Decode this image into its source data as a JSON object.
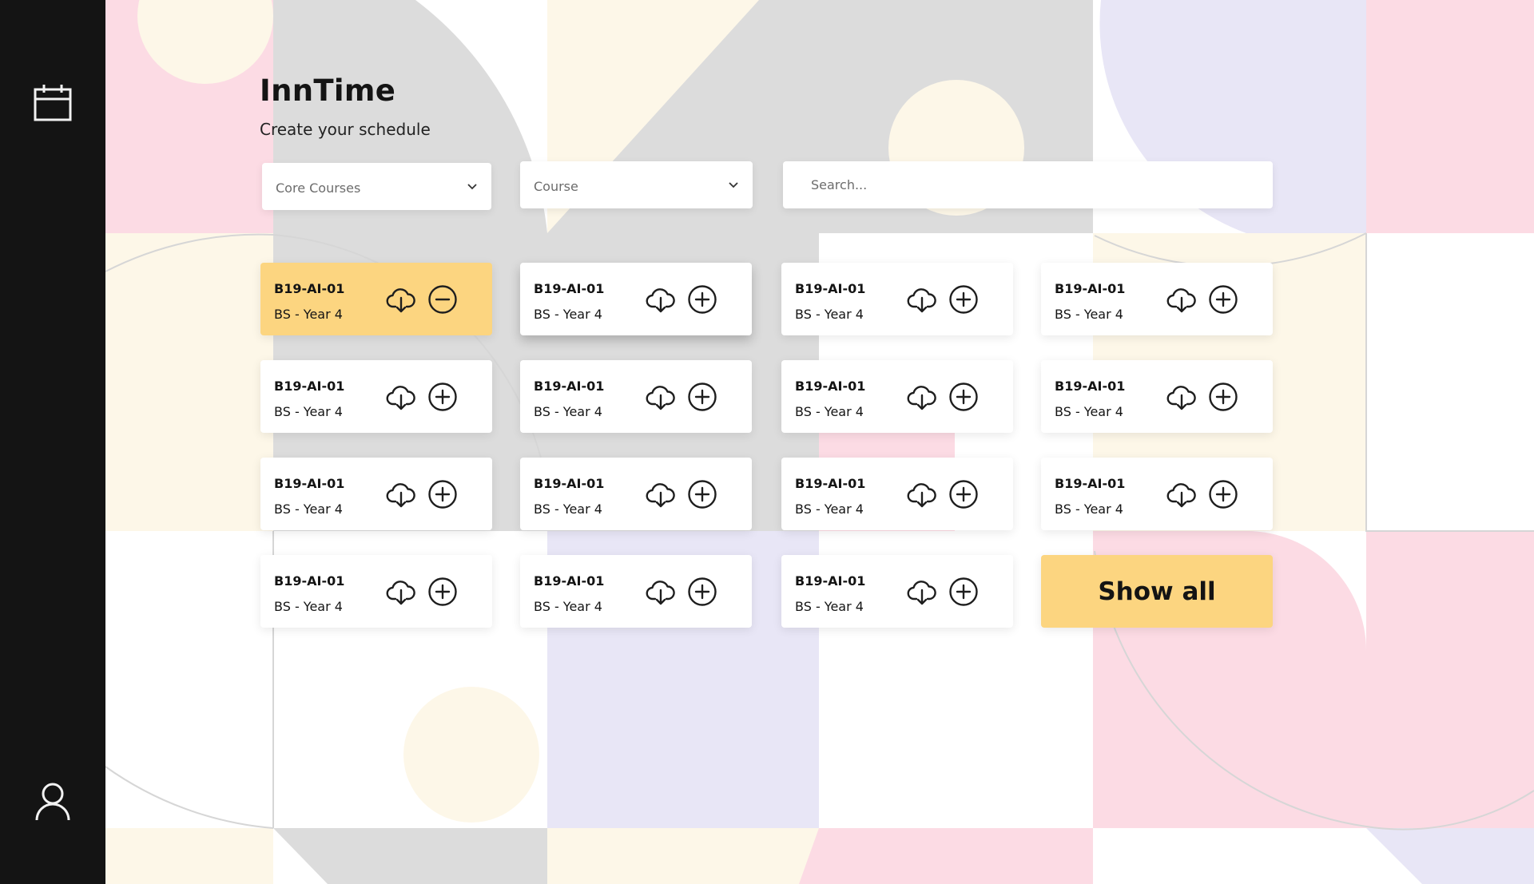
{
  "app": {
    "title": "InnTime",
    "subtitle": "Create your schedule"
  },
  "sidebar": {
    "top_icon": "calendar-icon",
    "bottom_icon": "user-icon"
  },
  "filters": {
    "category": {
      "value": "Core Courses",
      "icon": "chevron-down-icon"
    },
    "course": {
      "value": "Course",
      "icon": "chevron-down-icon"
    },
    "search": {
      "placeholder": "Search..."
    }
  },
  "courses": [
    {
      "code": "B19-AI-01",
      "group": "BS - Year 4",
      "selected": true,
      "action_icon": "minus-circle-icon"
    },
    {
      "code": "B19-AI-01",
      "group": "BS - Year 4",
      "selected": false,
      "action_icon": "plus-circle-icon"
    },
    {
      "code": "B19-AI-01",
      "group": "BS - Year 4",
      "selected": false,
      "action_icon": "plus-circle-icon"
    },
    {
      "code": "B19-AI-01",
      "group": "BS - Year 4",
      "selected": false,
      "action_icon": "plus-circle-icon"
    },
    {
      "code": "B19-AI-01",
      "group": "BS - Year 4",
      "selected": false,
      "action_icon": "plus-circle-icon"
    },
    {
      "code": "B19-AI-01",
      "group": "BS - Year 4",
      "selected": false,
      "action_icon": "plus-circle-icon"
    },
    {
      "code": "B19-AI-01",
      "group": "BS - Year 4",
      "selected": false,
      "action_icon": "plus-circle-icon"
    },
    {
      "code": "B19-AI-01",
      "group": "BS - Year 4",
      "selected": false,
      "action_icon": "plus-circle-icon"
    },
    {
      "code": "B19-AI-01",
      "group": "BS - Year 4",
      "selected": false,
      "action_icon": "plus-circle-icon"
    },
    {
      "code": "B19-AI-01",
      "group": "BS - Year 4",
      "selected": false,
      "action_icon": "plus-circle-icon"
    },
    {
      "code": "B19-AI-01",
      "group": "BS - Year 4",
      "selected": false,
      "action_icon": "plus-circle-icon"
    },
    {
      "code": "B19-AI-01",
      "group": "BS - Year 4",
      "selected": false,
      "action_icon": "plus-circle-icon"
    },
    {
      "code": "B19-AI-01",
      "group": "BS - Year 4",
      "selected": false,
      "action_icon": "plus-circle-icon"
    },
    {
      "code": "B19-AI-01",
      "group": "BS - Year 4",
      "selected": false,
      "action_icon": "plus-circle-icon"
    },
    {
      "code": "B19-AI-01",
      "group": "BS - Year 4",
      "selected": false,
      "action_icon": "plus-circle-icon"
    }
  ],
  "show_all_label": "Show all",
  "colors": {
    "sidebar": "#141414",
    "accent": "#fcd580",
    "bg_pink": "#fcdbe4",
    "bg_grey": "#dcdcdc",
    "bg_cream": "#fdf7e8",
    "bg_lavender": "#e8e6f6"
  }
}
